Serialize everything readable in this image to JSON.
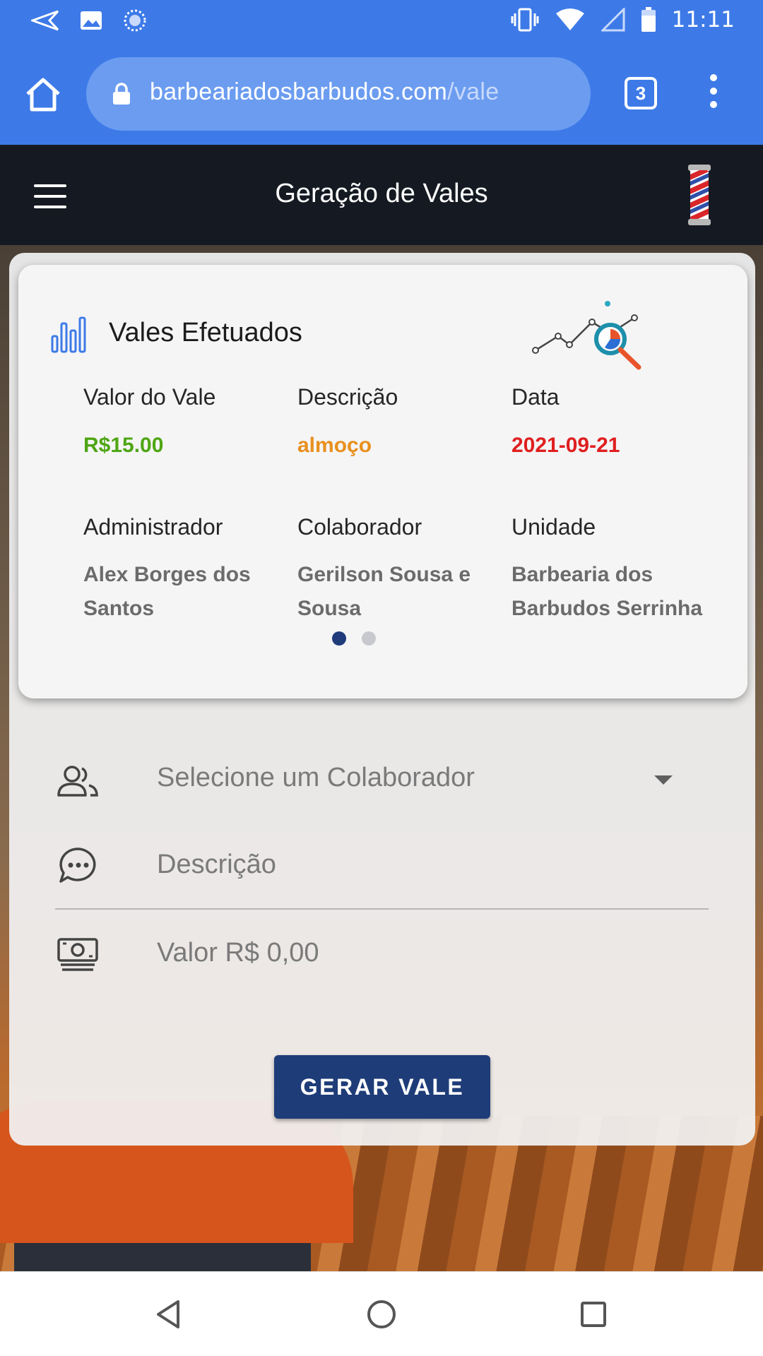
{
  "status_bar": {
    "time": "11:11",
    "icons": [
      "send-icon",
      "image-icon",
      "sync-icon",
      "vibrate-icon",
      "wifi-icon",
      "signal-icon",
      "battery-icon"
    ]
  },
  "browser": {
    "url_domain": "barbeariadosbarbudos.com",
    "url_path": "/vale",
    "tab_count": "3"
  },
  "header": {
    "title": "Geração de Vales"
  },
  "summary": {
    "title": "Vales Efetuados",
    "fields": [
      {
        "label": "Valor do Vale",
        "value": "R$15.00"
      },
      {
        "label": "Descrição",
        "value": "almoço"
      },
      {
        "label": "Data",
        "value": "2021-09-21"
      },
      {
        "label": "Administrador",
        "value": "Alex Borges dos Santos"
      },
      {
        "label": "Colaborador",
        "value": "Gerilson Sousa e Sousa"
      },
      {
        "label": "Unidade",
        "value": "Barbearia dos Barbudos Serrinha"
      }
    ],
    "carousel": {
      "pages": 2,
      "active": 1
    }
  },
  "form": {
    "collaborator_placeholder": "Selecione um Colaborador",
    "description_placeholder": "Descrição",
    "value_placeholder": "Valor R$ 0,00",
    "submit_label": "GERAR VALE"
  },
  "colors": {
    "browser_blue": "#3d7ae8",
    "header_dark": "#151a22",
    "button_navy": "#1e3c78",
    "value_green": "#4fa614",
    "description_orange": "#e8901e",
    "date_red": "#e01f1f"
  }
}
